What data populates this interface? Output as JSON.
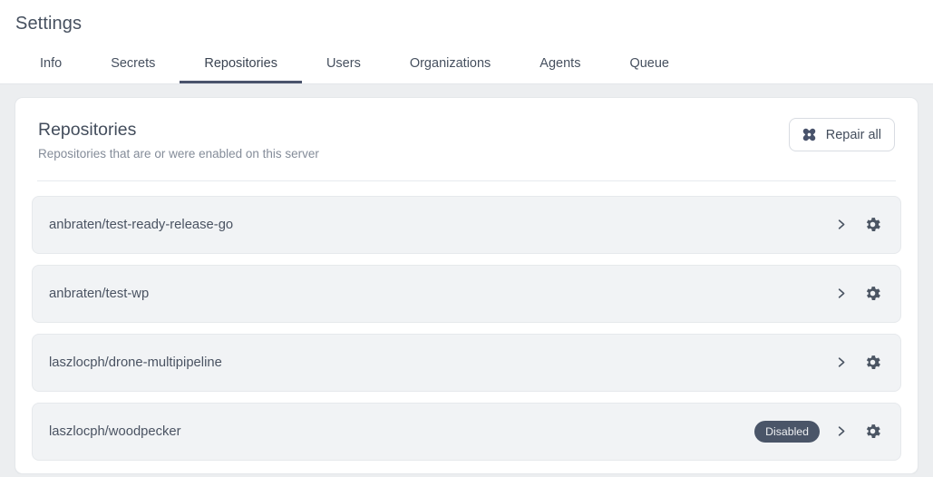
{
  "header": {
    "title": "Settings"
  },
  "tabs": [
    {
      "label": "Info",
      "active": false
    },
    {
      "label": "Secrets",
      "active": false
    },
    {
      "label": "Repositories",
      "active": true
    },
    {
      "label": "Users",
      "active": false
    },
    {
      "label": "Organizations",
      "active": false
    },
    {
      "label": "Agents",
      "active": false
    },
    {
      "label": "Queue",
      "active": false
    }
  ],
  "card": {
    "heading": "Repositories",
    "subtitle": "Repositories that are or were enabled on this server",
    "repair_button": {
      "label": "Repair all",
      "icon": "repair-plaster-icon"
    }
  },
  "repositories": [
    {
      "name": "anbraten/test-ready-release-go",
      "badge": null,
      "chevron_icon": "chevron-right-icon",
      "settings_icon": "gear-icon"
    },
    {
      "name": "anbraten/test-wp",
      "badge": null,
      "chevron_icon": "chevron-right-icon",
      "settings_icon": "gear-icon"
    },
    {
      "name": "laszlocph/drone-multipipeline",
      "badge": null,
      "chevron_icon": "chevron-right-icon",
      "settings_icon": "gear-icon"
    },
    {
      "name": "laszlocph/woodpecker",
      "badge": "Disabled",
      "chevron_icon": "chevron-right-icon",
      "settings_icon": "gear-icon"
    }
  ],
  "colors": {
    "page_background": "#eceef0",
    "card_background": "#ffffff",
    "row_background": "#f1f3f5",
    "text_primary": "#46505f",
    "text_muted": "#848c99",
    "active_tab_underline": "#49536b",
    "badge_background": "#4a5568",
    "badge_text": "#eef0f3"
  }
}
